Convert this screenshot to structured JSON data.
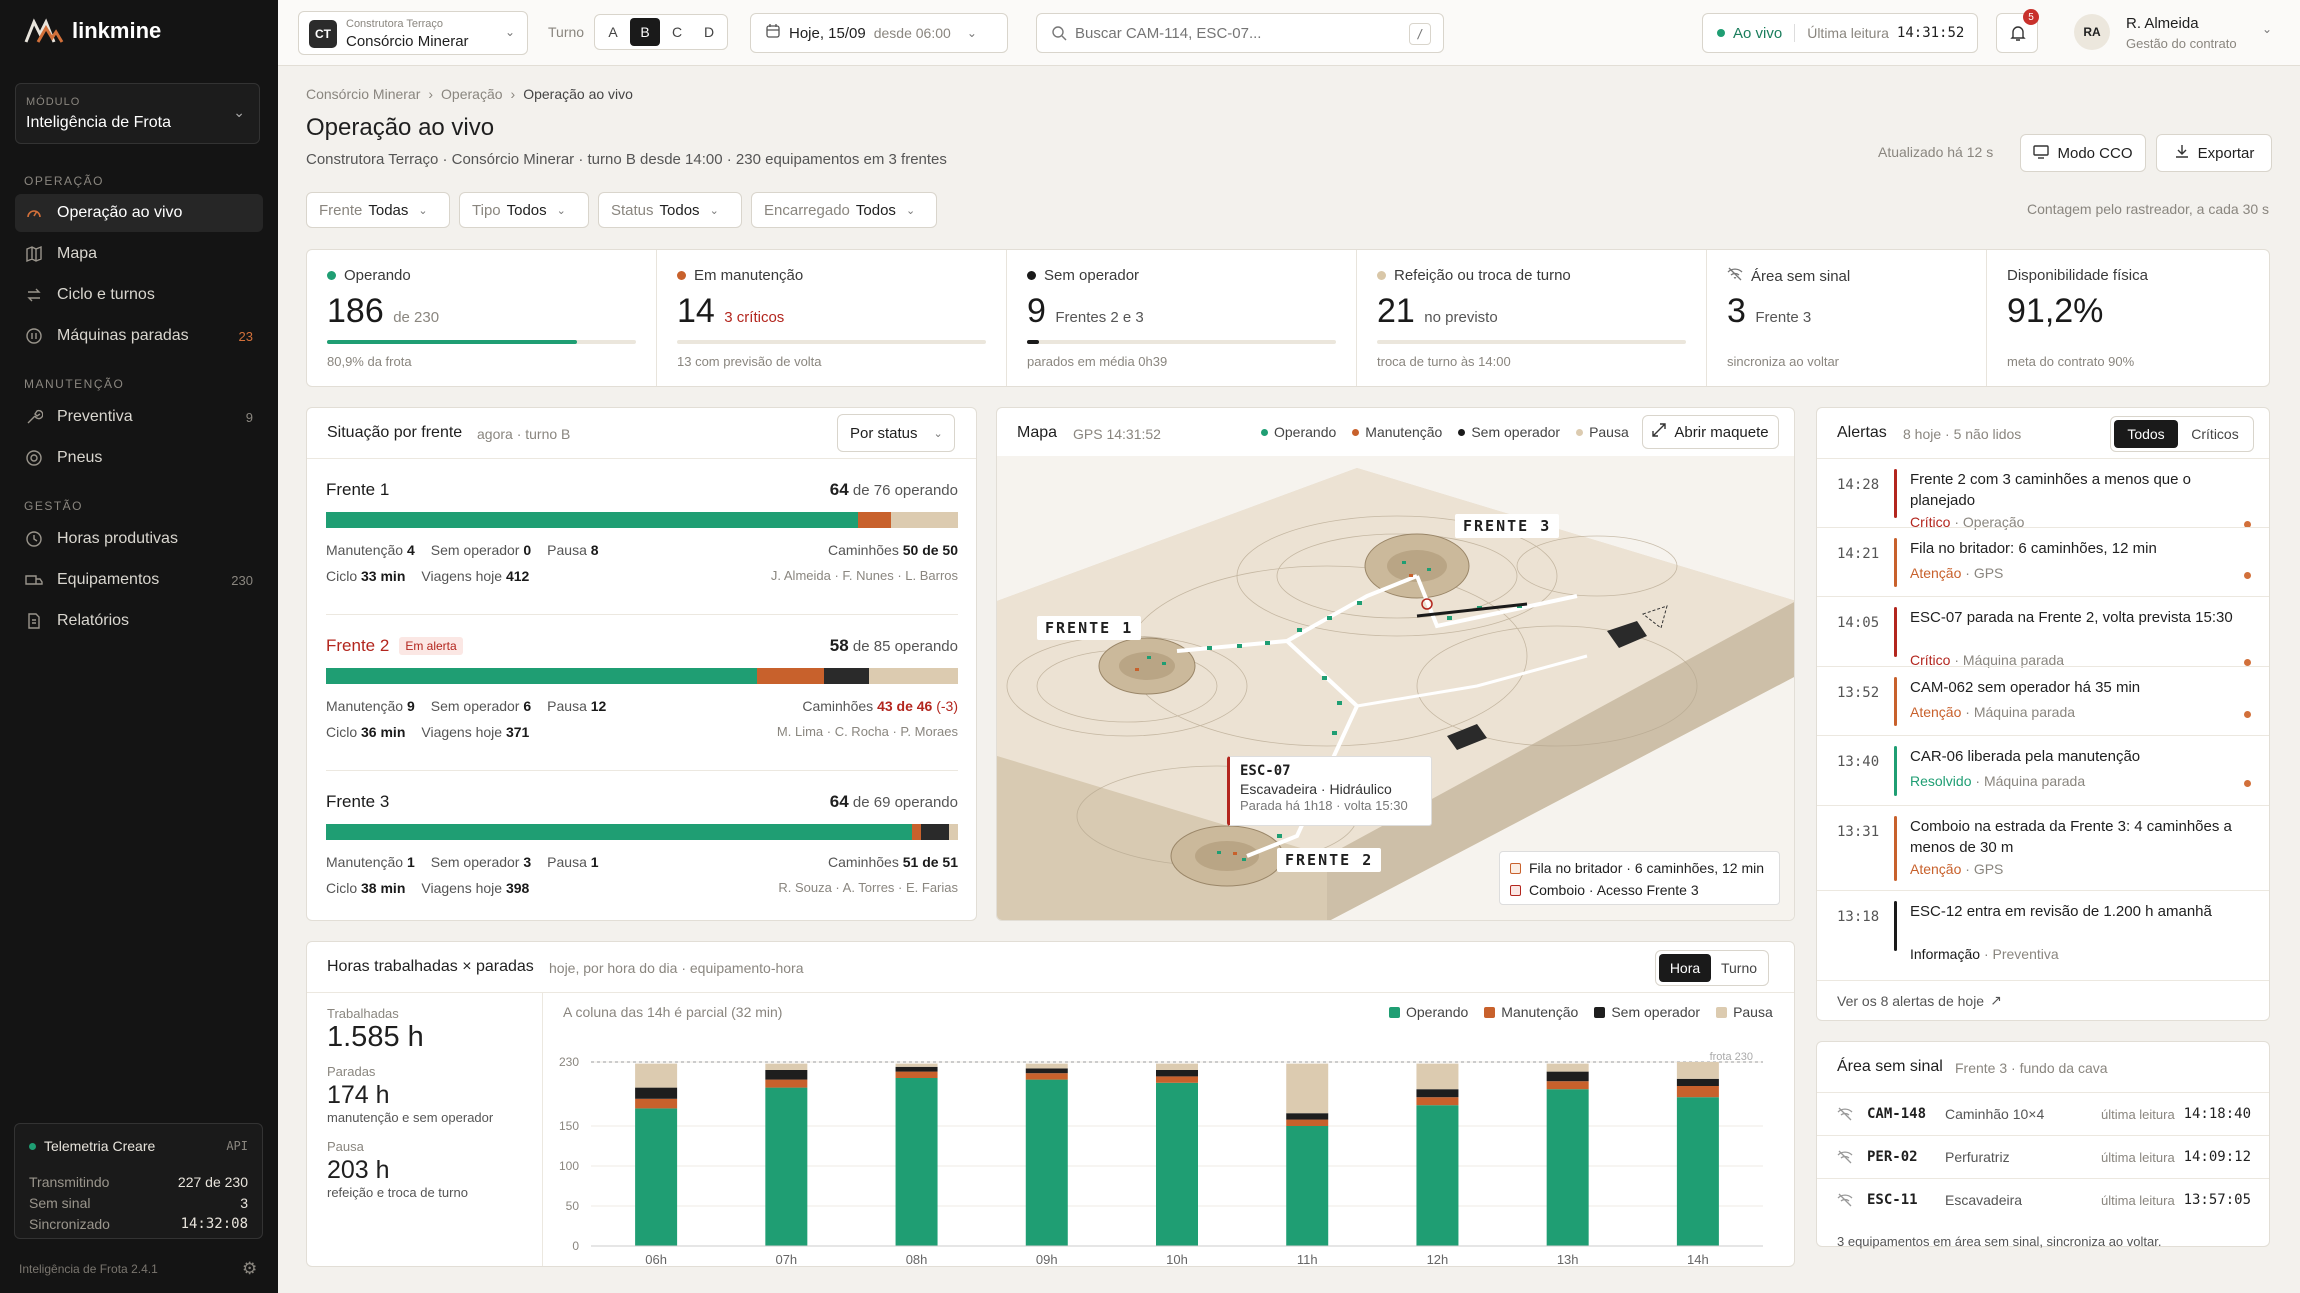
{
  "brand": {
    "name": "linkmine",
    "version": "Inteligência de Frota 2.4.1"
  },
  "module": {
    "key": "MÓDULO",
    "value": "Inteligência de Frota"
  },
  "nav": {
    "sections": [
      "OPERAÇÃO",
      "MANUTENÇÃO",
      "GESTÃO"
    ],
    "operacao": [
      {
        "label": "Operação ao vivo",
        "count": ""
      },
      {
        "label": "Mapa",
        "count": ""
      },
      {
        "label": "Ciclo e turnos",
        "count": ""
      },
      {
        "label": "Máquinas paradas",
        "count": "23"
      }
    ],
    "manutencao": [
      {
        "label": "Preventiva",
        "count": "9"
      },
      {
        "label": "Pneus",
        "count": ""
      }
    ],
    "gestao": [
      {
        "label": "Horas produtivas",
        "count": ""
      },
      {
        "label": "Equipamentos",
        "count": "230"
      },
      {
        "label": "Relatórios",
        "count": ""
      }
    ]
  },
  "telemetry": {
    "title": "Telemetria Creare",
    "tag": "API",
    "rows": [
      {
        "k": "Transmitindo",
        "v": "227 de 230"
      },
      {
        "k": "Sem sinal",
        "v": "3"
      },
      {
        "k": "Sincronizado",
        "v": "14:32:08"
      }
    ]
  },
  "topbar": {
    "company_badge": "CT",
    "company_small": "Construtora Terraço",
    "company": "Consórcio Minerar",
    "turno_label": "Turno",
    "turnos": [
      "A",
      "B",
      "C",
      "D"
    ],
    "turno_selected": "B",
    "date": "Hoje, 15/09",
    "date_since": "desde 06:00",
    "search_placeholder": "Buscar CAM-114, ESC-07...",
    "search_key": "/",
    "live": "Ao vivo",
    "last_read_label": "Última leitura",
    "last_read": "14:31:52",
    "notif_count": "5",
    "user_initials": "RA",
    "user_name": "R. Almeida",
    "user_role": "Gestão do contrato"
  },
  "page": {
    "breadcrumb": [
      "Consórcio Minerar",
      "Operação",
      "Operação ao vivo"
    ],
    "title": "Operação ao vivo",
    "subtitle": "Construtora Terraço · Consórcio Minerar · turno B desde 14:00 · 230 equipamentos em 3 frentes",
    "updated": "Atualizado há 12 s",
    "btn_cco": "Modo CCO",
    "btn_export": "Exportar",
    "count_note": "Contagem pelo rastreador, a cada 30 s"
  },
  "filters": [
    {
      "k": "Frente",
      "v": "Todas"
    },
    {
      "k": "Tipo",
      "v": "Todos"
    },
    {
      "k": "Status",
      "v": "Todos"
    },
    {
      "k": "Encarregado",
      "v": "Todos"
    }
  ],
  "kpis": [
    {
      "label": "Operando",
      "big": "186",
      "suffix": "de 230",
      "sub": "80,9% da frota",
      "color": "#1f9e73",
      "fill": 0.809
    },
    {
      "label": "Em manutenção",
      "big": "14",
      "suffix": "3 críticos",
      "sub": "13 com previsão de volta",
      "color": "#c8612c",
      "fill": 0
    },
    {
      "label": "Sem operador",
      "big": "9",
      "suffix": "Frentes 2 e 3",
      "sub": "parados em média 0h39",
      "color": "#1a1a1a",
      "fill": 0.04
    },
    {
      "label": "Refeição ou troca de turno",
      "big": "21",
      "suffix": "no previsto",
      "sub": "troca de turno às 14:00",
      "color": "#d9c7a8",
      "fill": 0
    },
    {
      "label": "Área sem sinal",
      "big": "3",
      "suffix": "Frente 3",
      "sub": "sincroniza ao voltar",
      "color": "#888"
    },
    {
      "label": "Disponibilidade física",
      "big": "91,2%",
      "suffix": "",
      "sub": "meta do contrato 90%",
      "color": ""
    }
  ],
  "fronts": {
    "title": "Situação por frente",
    "meta": "agora · turno B",
    "select": "Por status",
    "items": [
      {
        "name": "Frente 1",
        "alert": "",
        "op": "64",
        "total": "de 76 operando",
        "seg": [
          64,
          4,
          0,
          8
        ],
        "man": "4",
        "semop": "0",
        "pausa": "8",
        "cam_label": "Caminhões",
        "cam": "50 de 50",
        "cam_delta": "",
        "ciclo": "33 min",
        "viagens": "412",
        "people": "J. Almeida · F. Nunes · L. Barros"
      },
      {
        "name": "Frente 2",
        "alert": "Em alerta",
        "op": "58",
        "total": "de 85 operando",
        "seg": [
          58,
          9,
          6,
          12
        ],
        "man": "9",
        "semop": "6",
        "pausa": "12",
        "cam_label": "Caminhões",
        "cam": "43 de 46",
        "cam_delta": "(-3)",
        "ciclo": "36 min",
        "viagens": "371",
        "people": "M. Lima · C. Rocha · P. Moraes"
      },
      {
        "name": "Frente 3",
        "alert": "",
        "op": "64",
        "total": "de 69 operando",
        "seg": [
          64,
          1,
          3,
          1
        ],
        "man": "1",
        "semop": "3",
        "pausa": "1",
        "cam_label": "Caminhões",
        "cam": "51 de 51",
        "cam_delta": "",
        "ciclo": "38 min",
        "viagens": "398",
        "people": "R. Souza · A. Torres · E. Farias"
      }
    ],
    "labels": {
      "man": "Manutenção",
      "semop": "Sem operador",
      "pausa": "Pausa",
      "ciclo": "Ciclo",
      "viagens": "Viagens hoje"
    }
  },
  "map": {
    "title": "Mapa",
    "gps": "GPS 14:31:52",
    "legend": [
      "Operando",
      "Manutenção",
      "Sem operador",
      "Pausa"
    ],
    "open": "Abrir maquete",
    "fronts": [
      "FRENTE 1",
      "FRENTE 2",
      "FRENTE 3"
    ],
    "tooltip": {
      "id": "ESC-07",
      "type": "Escavadeira · Hidráulico",
      "status": "Parada há 1h18 · volta 15:30"
    },
    "notes": [
      "Fila no britador · 6 caminhões, 12 min",
      "Comboio · Acesso Frente 3"
    ]
  },
  "alerts": {
    "title": "Alertas",
    "meta": "8 hoje · 5 não lidos",
    "tabs": [
      "Todos",
      "Críticos"
    ],
    "items": [
      {
        "time": "14:28",
        "text": "Frente 2 com 3 caminhões a menos que o planejado",
        "sev": "Crítico",
        "src": "Operação",
        "color": "#b3261e",
        "unread": true
      },
      {
        "time": "14:21",
        "text": "Fila no britador: 6 caminhões, 12 min",
        "sev": "Atenção",
        "src": "GPS",
        "color": "#c8612c",
        "unread": true
      },
      {
        "time": "14:05",
        "text": "ESC-07 parada na Frente 2, volta prevista 15:30",
        "sev": "Crítico",
        "src": "Máquina parada",
        "color": "#b3261e",
        "unread": true
      },
      {
        "time": "13:52",
        "text": "CAM-062 sem operador há 35 min",
        "sev": "Atenção",
        "src": "Máquina parada",
        "color": "#c8612c",
        "unread": true
      },
      {
        "time": "13:40",
        "text": "CAR-06 liberada pela manutenção",
        "sev": "Resolvido",
        "src": "Máquina parada",
        "color": "#1f9e73",
        "unread": true
      },
      {
        "time": "13:31",
        "text": "Comboio na estrada da Frente 3: 4 caminhões a menos de 30 m",
        "sev": "Atenção",
        "src": "GPS",
        "color": "#c8612c",
        "unread": false
      },
      {
        "time": "13:18",
        "text": "ESC-12 entra em revisão de 1.200 h amanhã",
        "sev": "Informação",
        "src": "Preventiva",
        "color": "#1a1a1a",
        "unread": false
      }
    ],
    "see_all": "Ver os 8 alertas de hoje"
  },
  "nosignal": {
    "title": "Área sem sinal",
    "meta": "Frente 3 · fundo da cava",
    "read_label": "última leitura",
    "items": [
      {
        "id": "CAM-148",
        "type": "Caminhão 10×4",
        "time": "14:18:40"
      },
      {
        "id": "PER-02",
        "type": "Perfuratriz",
        "time": "14:09:12"
      },
      {
        "id": "ESC-11",
        "type": "Escavadeira",
        "time": "13:57:05"
      }
    ],
    "foot": "3 equipamentos em área sem sinal, sincroniza ao voltar."
  },
  "hours": {
    "title": "Horas trabalhadas × paradas",
    "meta": "hoje, por hora do dia · equipamento-hora",
    "tabs": [
      "Hora",
      "Turno"
    ],
    "stats": [
      {
        "k": "Trabalhadas",
        "v": "1.585 h",
        "d": ""
      },
      {
        "k": "Paradas",
        "v": "174 h",
        "d": "manutenção e sem operador"
      },
      {
        "k": "Pausa",
        "v": "203 h",
        "d": "refeição e troca de turno"
      }
    ],
    "note": "A coluna das 14h é parcial (32 min)",
    "frota_label": "frota 230"
  },
  "chart_data": {
    "type": "bar",
    "stacked": true,
    "categories": [
      "06h",
      "07h",
      "08h",
      "09h",
      "10h",
      "11h",
      "12h",
      "13h",
      "14h"
    ],
    "series": [
      {
        "name": "Operando",
        "color": "#1f9e73",
        "values": [
          172,
          198,
          210,
          208,
          204,
          150,
          176,
          196,
          186
        ]
      },
      {
        "name": "Manutenção",
        "color": "#c8612c",
        "values": [
          12,
          10,
          8,
          8,
          8,
          8,
          10,
          10,
          14
        ]
      },
      {
        "name": "Sem operador",
        "color": "#1e1e1e",
        "values": [
          14,
          12,
          6,
          6,
          8,
          8,
          10,
          12,
          9
        ]
      },
      {
        "name": "Pausa",
        "color": "#dccbb0",
        "values": [
          30,
          8,
          4,
          6,
          8,
          62,
          32,
          10,
          21
        ]
      }
    ],
    "ylim": [
      0,
      230
    ],
    "yticks": [
      0,
      50,
      100,
      150,
      230
    ],
    "reference_line": 230
  }
}
